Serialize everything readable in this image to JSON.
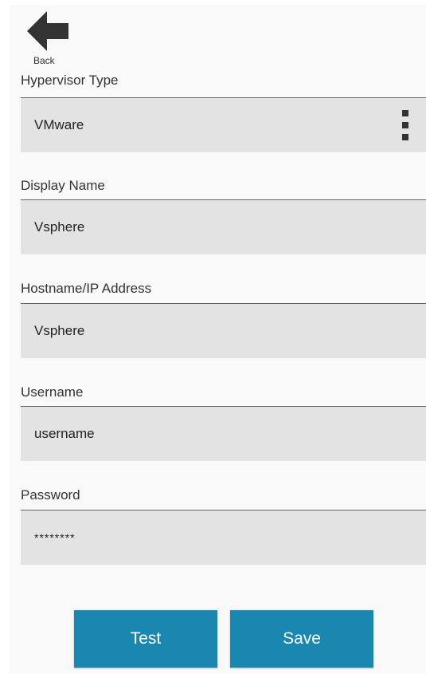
{
  "back": {
    "label": "Back",
    "icon": "arrow-left-icon"
  },
  "form": {
    "hypervisor_type": {
      "label": "Hypervisor Type",
      "value": "VMware",
      "menu_icon": "kebab-menu-icon"
    },
    "display_name": {
      "label": "Display Name",
      "value": "Vsphere"
    },
    "hostname": {
      "label": "Hostname/IP Address",
      "value": "Vsphere"
    },
    "username": {
      "label": "Username",
      "value": "username"
    },
    "password": {
      "label": "Password",
      "value": "********"
    }
  },
  "actions": {
    "test_label": "Test",
    "save_label": "Save"
  },
  "colors": {
    "button_bg": "#1a87b0",
    "field_bg": "#e3e3e3",
    "panel_bg": "#f9f9f9"
  }
}
